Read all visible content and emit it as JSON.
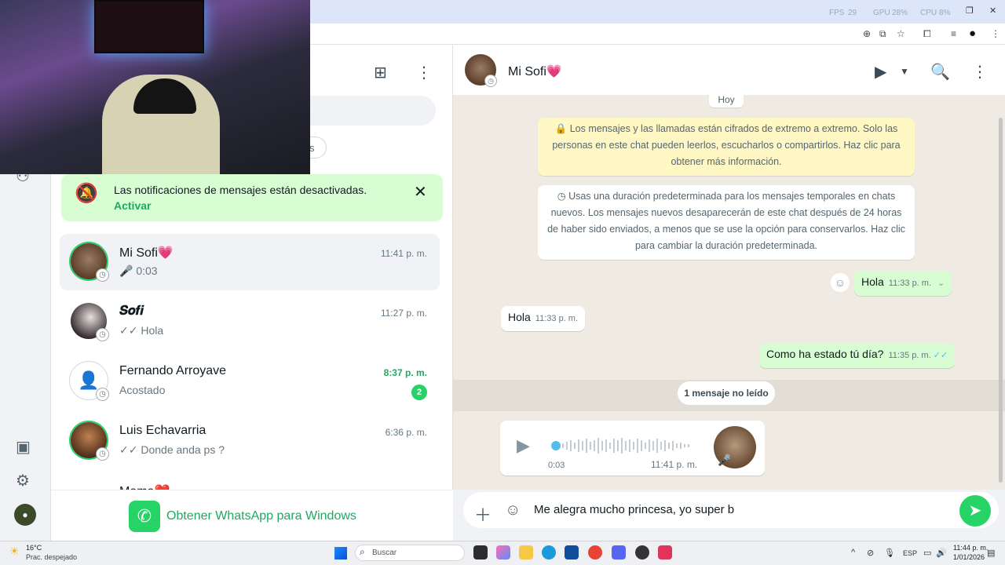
{
  "browser": {
    "stats": {
      "fps_label": "FPS",
      "fps_value": "29",
      "gpu_label": "GPU",
      "gpu_value": "28%",
      "cpu_label": "CPU",
      "cpu_value": "8%"
    }
  },
  "list": {
    "filter_fragment": "s",
    "notification": {
      "text": "Las notificaciones de mensajes están desactivadas.",
      "action": "Activar"
    },
    "chats": [
      {
        "name": "Mi Sofi💗",
        "time": "11:41 p. m.",
        "last": "🎤 0:03",
        "unread": "",
        "active": true
      },
      {
        "name": "𝑺𝒐𝒇𝒊",
        "time": "11:27 p. m.",
        "last": "✓✓ Hola",
        "unread": "",
        "active": false
      },
      {
        "name": "Fernando Arroyave",
        "time": "8:37 p. m.",
        "last": "Acostado",
        "unread": "2",
        "active": false
      },
      {
        "name": "Luis Echavarria",
        "time": "6:36 p. m.",
        "last": "✓✓ Donde anda ps ?",
        "unread": "",
        "active": false
      },
      {
        "name": "Mama❤️",
        "time": "",
        "last": "",
        "unread": "",
        "active": false
      }
    ],
    "get_app": "Obtener WhatsApp para Windows"
  },
  "conversation": {
    "contact_name": "Mi Sofi💗",
    "day": "Hoy",
    "encryption_notice": "🔒 Los mensajes y las llamadas están cifrados de extremo a extremo. Solo las personas en este chat pueden leerlos, escucharlos o compartirlos. Haz clic para obtener más información.",
    "timer_notice": "Usas una duración predeterminada para los mensajes temporales en chats nuevos. Los mensajes nuevos desaparecerán de este chat después de 24 horas de haber sido enviados, a menos que se use la opción para conservarlos. Haz clic para cambiar la duración predeterminada.",
    "messages": [
      {
        "dir": "out",
        "text": "Hola",
        "time": "11:33 p. m."
      },
      {
        "dir": "in",
        "text": "Hola",
        "time": "11:33 p. m."
      },
      {
        "dir": "out",
        "text": "Como ha estado tú día?",
        "time": "11:35 p. m."
      }
    ],
    "unread_divider": "1 mensaje no leído",
    "voice_note": {
      "duration": "0:03",
      "time": "11:41 p. m."
    },
    "composer_text": "Me alegra mucho princesa, yo super b"
  },
  "taskbar": {
    "weather_temp": "16°C",
    "weather_desc": "Prac. despejado",
    "search": "Buscar",
    "lang": "ESP",
    "time": "11:44 p. m.",
    "date": "1/01/2026"
  },
  "colors": {
    "accent": "#25d366",
    "accent_text": "#1daa61",
    "out_bubble": "#d9fdd3",
    "notice": "#fff8c5"
  }
}
